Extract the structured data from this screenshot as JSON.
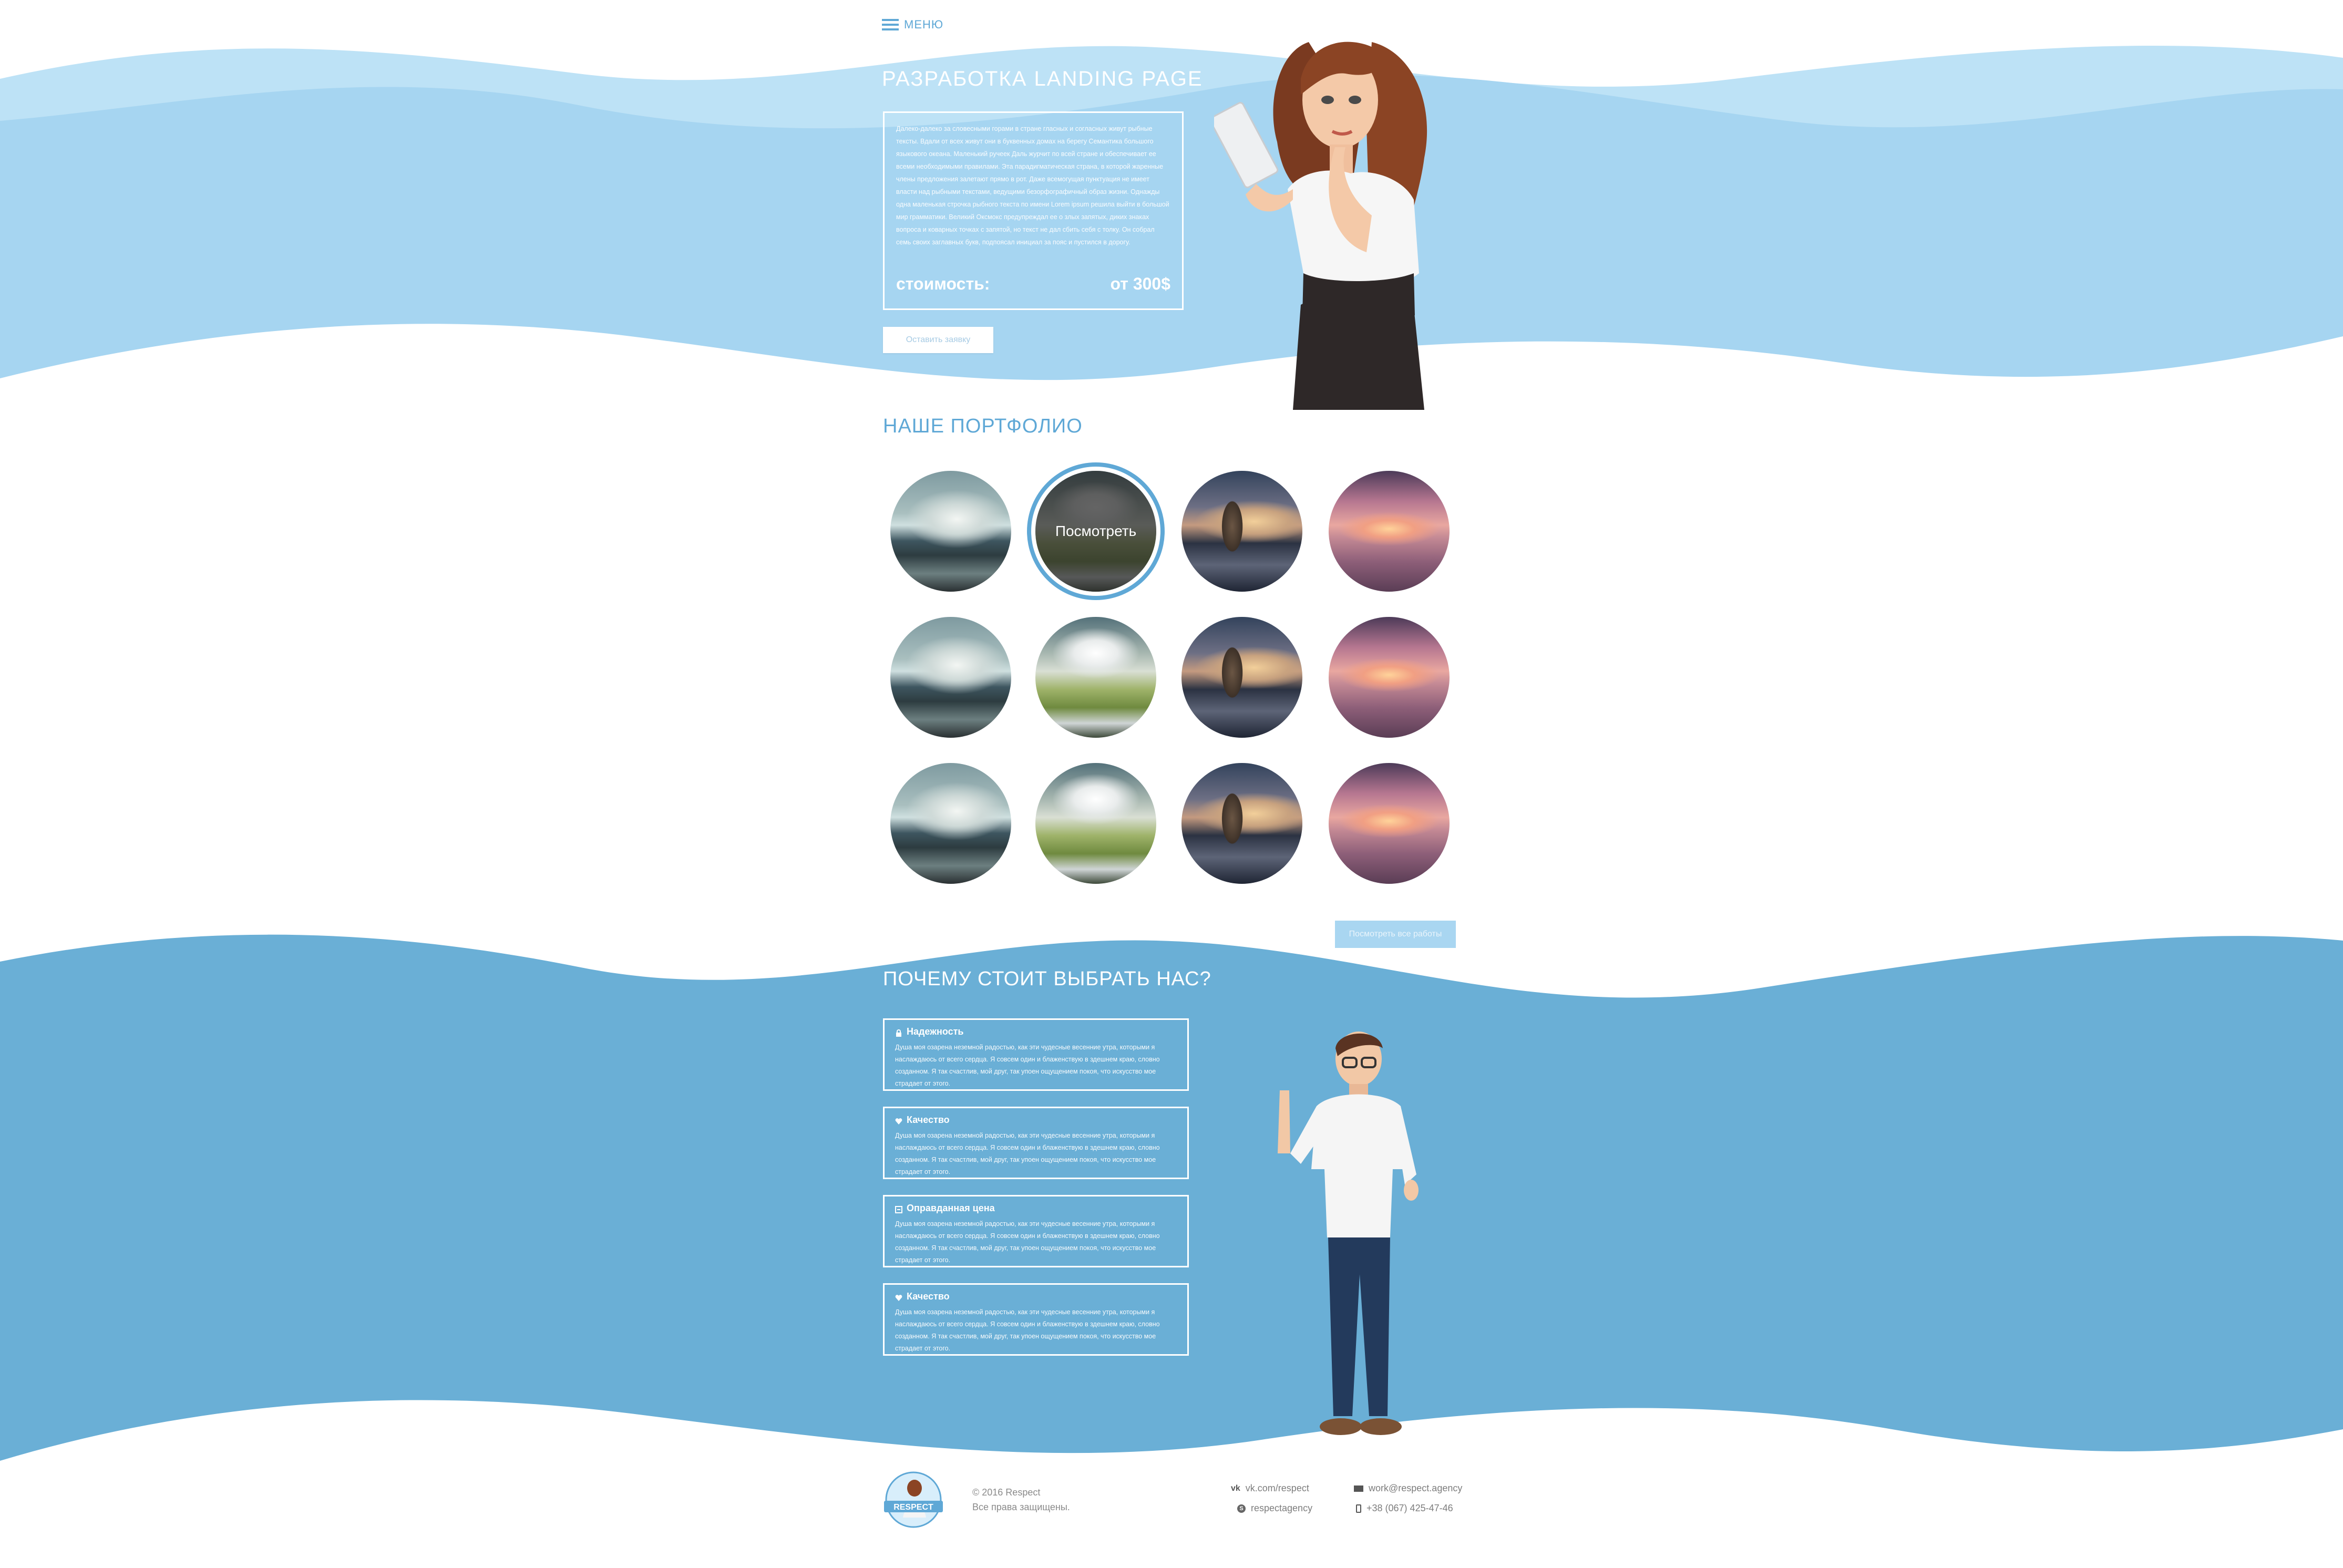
{
  "header": {
    "menu_label": "МЕНЮ"
  },
  "hero": {
    "title": "РАЗРАБОТКА LANDING PAGE",
    "description": "Далеко-далеко за словесными горами в стране гласных и согласных живут рыбные тексты. Вдали от всех живут они в буквенных домах на берегу Семантика большого языкового океана. Маленький ручеек Даль журчит по всей стране и обеспечивает ее всеми необходимыми правилами. Эта парадигматическая страна, в которой жаренные члены предложения залетают прямо в рот. Даже всемогущая пунктуация не имеет власти над рыбными текстами, ведущими безорфографичный образ жизни. Однажды одна маленькая строчка рыбного текста по имени Lorem ipsum решила выйти в большой мир грамматики. Великий Оксмокс предупреждал ее о злых запятых, диких знаках вопроса и коварных точках с запятой, но текст не дал сбить себя с толку. Он собрал семь своих заглавных букв, подпоясал инициал за пояс и пустился в дорогу.",
    "price_label": "стоимость:",
    "price_value": "от 300$",
    "order_button": "Оставить заявку"
  },
  "portfolio": {
    "title": "НАШЕ ПОРТФОЛИО",
    "hover_label": "Посмотреть",
    "items": [
      {
        "image": "coast",
        "hover": false
      },
      {
        "image": "clouds",
        "hover": true
      },
      {
        "image": "rock",
        "hover": false
      },
      {
        "image": "sunset",
        "hover": false
      },
      {
        "image": "coast",
        "hover": false
      },
      {
        "image": "clouds",
        "hover": false
      },
      {
        "image": "rock",
        "hover": false
      },
      {
        "image": "sunset",
        "hover": false
      },
      {
        "image": "coast",
        "hover": false
      },
      {
        "image": "clouds",
        "hover": false
      },
      {
        "image": "rock",
        "hover": false
      },
      {
        "image": "sunset",
        "hover": false
      }
    ],
    "all_works_button": "Посмотреть все работы"
  },
  "why": {
    "title": "ПОЧЕМУ СТОИТ ВЫБРАТЬ НАС?",
    "features": [
      {
        "icon": "lock-icon",
        "title": "Надежность",
        "text": "Душа моя озарена неземной радостью, как эти чудесные весенние утра, которыми я наслаждаюсь от всего сердца. Я совсем один и блаженствую в здешнем краю, словно созданном. Я так счастлив, мой друг, так упоен ощущением покоя, что искусство мое страдает от этого."
      },
      {
        "icon": "heart-icon",
        "title": "Качество",
        "text": "Душа моя озарена неземной радостью, как эти чудесные весенние утра, которыми я наслаждаюсь от всего сердца. Я совсем один и блаженствую в здешнем краю, словно созданном. Я так счастлив, мой друг, так упоен ощущением покоя, что искусство мое страдает от этого."
      },
      {
        "icon": "price-tag-icon",
        "title": "Оправданная цена",
        "text": "Душа моя озарена неземной радостью, как эти чудесные весенние утра, которыми я наслаждаюсь от всего сердца. Я совсем один и блаженствую в здешнем краю, словно созданном. Я так счастлив, мой друг, так упоен ощущением покоя, что искусство мое страдает от этого."
      },
      {
        "icon": "heart-icon",
        "title": "Качество",
        "text": "Душа моя озарена неземной радостью, как эти чудесные весенние утра, которыми я наслаждаюсь от всего сердца. Я совсем один и блаженствую в здешнем краю, словно созданном. Я так счастлив, мой друг, так упоен ощущением покоя, что искусство мое страдает от этого."
      }
    ]
  },
  "footer": {
    "logo_text": "RESPECT",
    "copyright": "© 2016 Respect",
    "rights": "Все права защищены.",
    "vk": "vk.com/respect",
    "skype": "respectagency",
    "email": "work@respect.agency",
    "phone": "+38 (067) 425-47-46"
  },
  "colors": {
    "light_blue": "#a6d5f1",
    "pale_blue": "#bde2f6",
    "dark_blue": "#6aafd6",
    "accent": "#5fa8d6"
  }
}
